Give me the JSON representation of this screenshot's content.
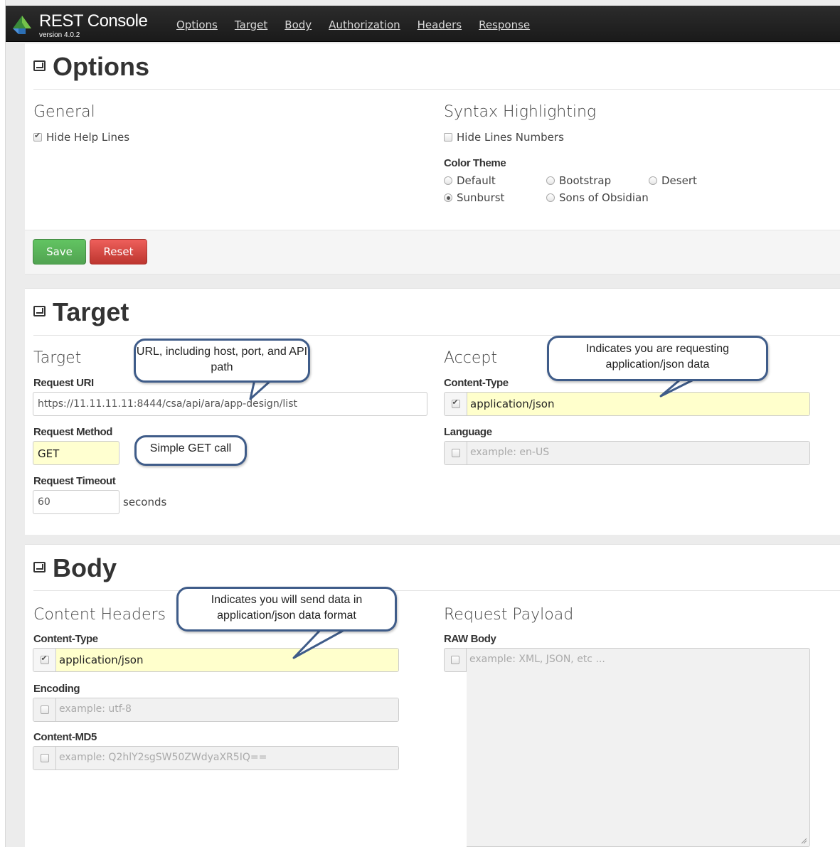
{
  "app": {
    "title": "REST Console",
    "version": "version 4.0.2"
  },
  "nav": [
    "Options",
    "Target",
    "Body",
    "Authorization",
    "Headers",
    "Response"
  ],
  "options": {
    "title": "Options",
    "general": {
      "title": "General",
      "hide_help_lines": "Hide Help Lines",
      "hide_help_lines_checked": true
    },
    "syntax": {
      "title": "Syntax Highlighting",
      "hide_line_numbers": "Hide Lines Numbers",
      "hide_line_numbers_checked": false,
      "color_theme_label": "Color Theme",
      "themes": [
        "Default",
        "Bootstrap",
        "Desert",
        "Sunburst",
        "Sons of Obsidian"
      ],
      "selected_theme": "Sunburst"
    },
    "save_label": "Save",
    "reset_label": "Reset"
  },
  "target": {
    "title": "Target",
    "col_title": "Target",
    "request_uri_label": "Request URI",
    "request_uri_value": "https://11.11.11.11:8444/csa/api/ara/app-design/list",
    "request_method_label": "Request Method",
    "request_method_value": "GET",
    "request_timeout_label": "Request Timeout",
    "request_timeout_value": "60",
    "seconds_label": "seconds",
    "accept": {
      "title": "Accept",
      "content_type_label": "Content-Type",
      "content_type_value": "application/json",
      "language_label": "Language",
      "language_placeholder": "example: en-US"
    },
    "callouts": {
      "uri": "URL, including host, port, and API path",
      "method": "Simple GET call",
      "accept": "Indicates you are requesting application/json data"
    }
  },
  "body": {
    "title": "Body",
    "content_headers": {
      "title": "Content Headers",
      "content_type_label": "Content-Type",
      "content_type_value": "application/json",
      "encoding_label": "Encoding",
      "encoding_placeholder": "example: utf-8",
      "md5_label": "Content-MD5",
      "md5_placeholder": "example: Q2hlY2sgSW50ZWdyaXR5IQ=="
    },
    "payload": {
      "title": "Request Payload",
      "raw_body_label": "RAW Body",
      "raw_body_placeholder": "example: XML, JSON, etc ..."
    },
    "callout": "Indicates you will send data in application/json data format"
  }
}
